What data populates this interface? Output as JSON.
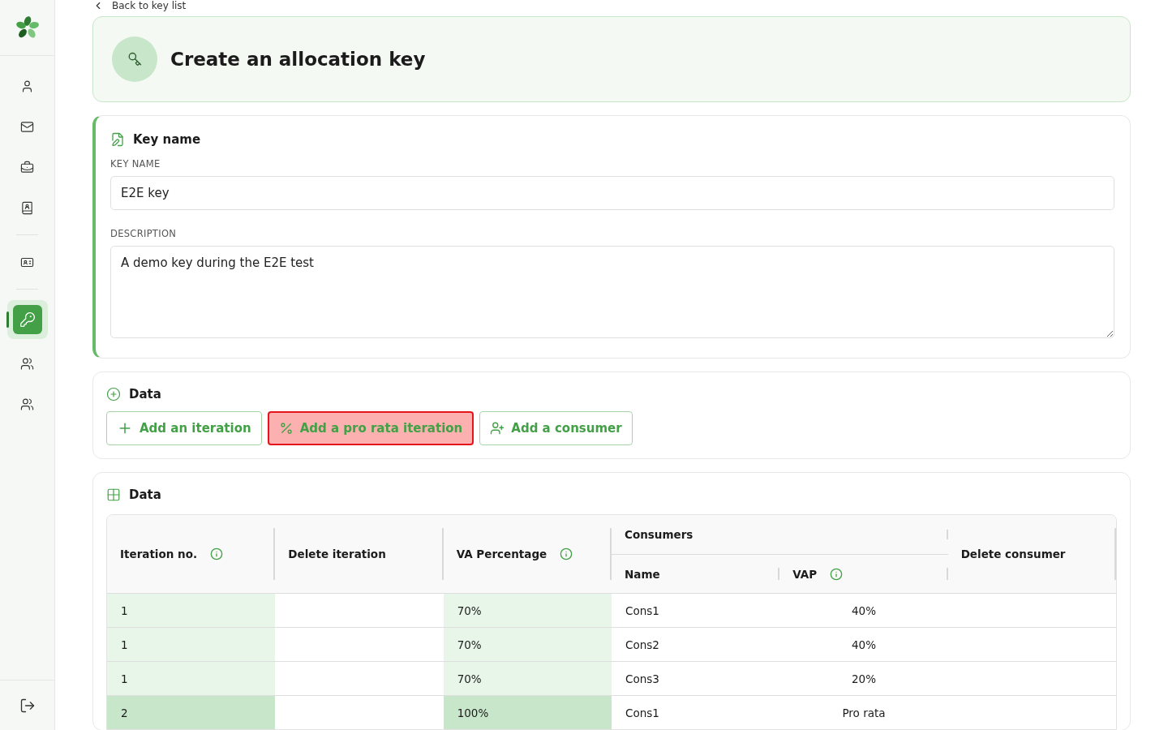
{
  "sidebar": {
    "items": [
      {
        "selected": false
      },
      {
        "selected": false
      },
      {
        "selected": false
      },
      {
        "selected": false
      },
      {
        "selected": false
      },
      {
        "selected": true
      },
      {
        "selected": false
      },
      {
        "selected": false
      }
    ]
  },
  "back_link": "Back to key list",
  "header": {
    "title": "Create an allocation key"
  },
  "key_section": {
    "title": "Key name",
    "fields": [
      {
        "kind": "input",
        "label": "KEY NAME",
        "value": "E2E key"
      },
      {
        "kind": "textarea",
        "label": "DESCRIPTION",
        "value": "A demo key during the E2E test"
      }
    ]
  },
  "actions_section": {
    "title": "Data",
    "buttons": [
      {
        "label": "Add an iteration",
        "highlighted": false
      },
      {
        "label": "Add a pro rata iteration",
        "highlighted": true
      },
      {
        "label": "Add a consumer",
        "highlighted": false
      }
    ]
  },
  "table_section": {
    "title": "Data",
    "headers": {
      "iteration": "Iteration no.",
      "delete_iteration": "Delete iteration",
      "va_percentage": "VA Percentage",
      "consumers": "Consumers",
      "name": "Name",
      "vap": "VAP",
      "delete_consumer": "Delete consumer"
    },
    "rows": [
      {
        "iteration": "1",
        "va_percentage": "70%",
        "name": "Cons1",
        "vap": "40%",
        "color": "#e8f5e9"
      },
      {
        "iteration": "1",
        "va_percentage": "70%",
        "name": "Cons2",
        "vap": "40%",
        "color": "#e8f5e9"
      },
      {
        "iteration": "1",
        "va_percentage": "70%",
        "name": "Cons3",
        "vap": "20%",
        "color": "#e8f5e9"
      },
      {
        "iteration": "2",
        "va_percentage": "100%",
        "name": "Cons1",
        "vap": "Pro rata",
        "color": "#c8e6c9"
      }
    ]
  }
}
